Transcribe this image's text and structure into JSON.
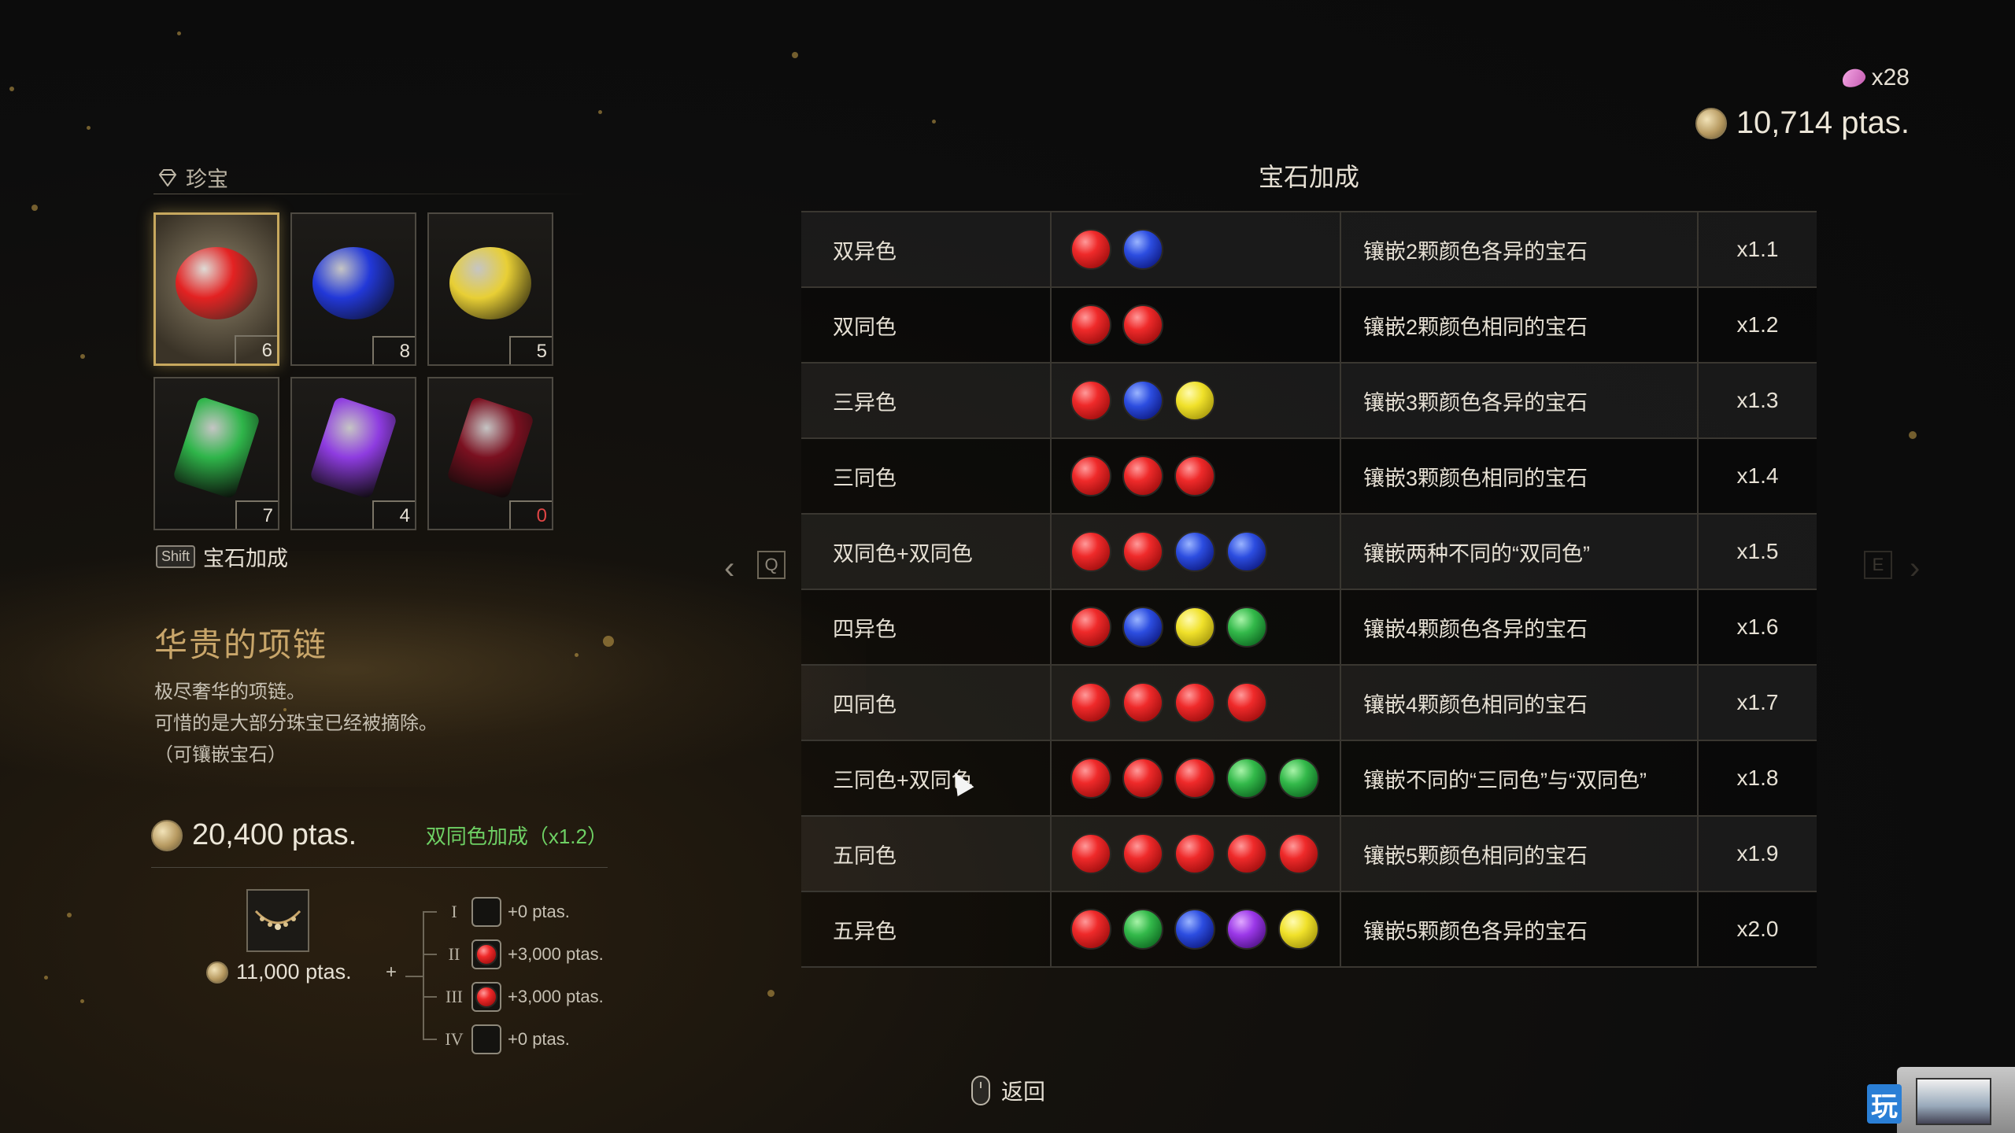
{
  "currency": {
    "spinel_count": "x28",
    "ptas": "10,714 ptas."
  },
  "left_panel": {
    "section_label": "珍宝",
    "gems": [
      {
        "color": "#e32222",
        "shape": "oval",
        "count": "6",
        "selected": true
      },
      {
        "color": "#2238d8",
        "shape": "oval",
        "count": "8",
        "selected": false
      },
      {
        "color": "#e8cf35",
        "shape": "oval",
        "count": "5",
        "selected": false
      },
      {
        "color": "#2fb54a",
        "shape": "rect",
        "count": "7",
        "selected": false
      },
      {
        "color": "#8e3ce0",
        "shape": "rect",
        "count": "4",
        "selected": false
      },
      {
        "color": "#7a1020",
        "shape": "rect",
        "count": "0",
        "selected": false
      }
    ],
    "shift_key": "Shift",
    "shift_label": "宝石加成",
    "item_name": "华贵的项链",
    "item_desc_1": "极尽奢华的项链。",
    "item_desc_2": "可惜的是大部分珠宝已经被摘除。",
    "item_desc_3": "（可镶嵌宝石）",
    "total_price": "20,400 ptas.",
    "bonus_label": "双同色加成（x1.2）",
    "base_price": "11,000 ptas.",
    "plus_sign": "+",
    "slots": [
      {
        "roman": "I",
        "filled": false,
        "value": "+0 ptas."
      },
      {
        "roman": "II",
        "filled": true,
        "value": "+3,000 ptas."
      },
      {
        "roman": "III",
        "filled": true,
        "value": "+3,000 ptas."
      },
      {
        "roman": "IV",
        "filled": false,
        "value": "+0 ptas."
      }
    ]
  },
  "nav": {
    "q_key": "Q",
    "e_key": "E",
    "left_arrow": "‹",
    "right_arrow": "›"
  },
  "table": {
    "title": "宝石加成",
    "rows": [
      {
        "name": "双异色",
        "gems": [
          "red",
          "blue"
        ],
        "desc": "镶嵌2颗颜色各异的宝石",
        "mult": "x1.1"
      },
      {
        "name": "双同色",
        "gems": [
          "red",
          "red"
        ],
        "desc": "镶嵌2颗颜色相同的宝石",
        "mult": "x1.2"
      },
      {
        "name": "三异色",
        "gems": [
          "red",
          "blue",
          "yellow"
        ],
        "desc": "镶嵌3颗颜色各异的宝石",
        "mult": "x1.3"
      },
      {
        "name": "三同色",
        "gems": [
          "red",
          "red",
          "red"
        ],
        "desc": "镶嵌3颗颜色相同的宝石",
        "mult": "x1.4"
      },
      {
        "name": "双同色+双同色",
        "gems": [
          "red",
          "red",
          "blue",
          "blue"
        ],
        "desc": "镶嵌两种不同的“双同色”",
        "mult": "x1.5"
      },
      {
        "name": "四异色",
        "gems": [
          "red",
          "blue",
          "yellow",
          "green"
        ],
        "desc": "镶嵌4颗颜色各异的宝石",
        "mult": "x1.6"
      },
      {
        "name": "四同色",
        "gems": [
          "red",
          "red",
          "red",
          "red"
        ],
        "desc": "镶嵌4颗颜色相同的宝石",
        "mult": "x1.7"
      },
      {
        "name": "三同色+双同色",
        "gems": [
          "red",
          "red",
          "red",
          "green",
          "green"
        ],
        "desc": "镶嵌不同的“三同色”与“双同色”",
        "mult": "x1.8"
      },
      {
        "name": "五同色",
        "gems": [
          "red",
          "red",
          "red",
          "red",
          "red"
        ],
        "desc": "镶嵌5颗颜色相同的宝石",
        "mult": "x1.9"
      },
      {
        "name": "五异色",
        "gems": [
          "red",
          "green",
          "blue",
          "purple",
          "yellow"
        ],
        "desc": "镶嵌5颗颜色各异的宝石",
        "mult": "x2.0"
      }
    ]
  },
  "footer": {
    "back_label": "返回"
  },
  "watermark": {
    "char": "玩"
  }
}
